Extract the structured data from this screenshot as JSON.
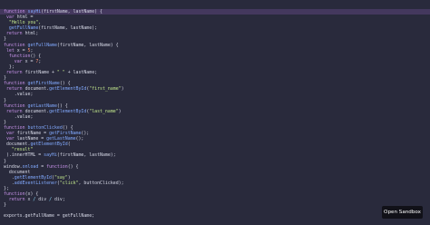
{
  "colors": {
    "background": "#292a3c",
    "highlight": "#44385e",
    "keyword": "#c792ea",
    "function": "#82aaff",
    "string": "#c3e88d",
    "number": "#f78c6c",
    "text": "#d6d8e6",
    "button_bg": "#111118"
  },
  "code_lines": [
    {
      "hl": true,
      "tokens": [
        [
          "key",
          "function "
        ],
        [
          "fn",
          "sayHi"
        ],
        [
          "txt",
          "(firstName, lastName) {"
        ]
      ]
    },
    {
      "tokens": [
        [
          "txt",
          " "
        ],
        [
          "key",
          "var"
        ],
        [
          "txt",
          " html ="
        ]
      ]
    },
    {
      "tokens": [
        [
          "str",
          "  \"Hello you\","
        ]
      ]
    },
    {
      "tokens": [
        [
          "txt",
          "  "
        ],
        [
          "fn",
          "getFullName"
        ],
        [
          "txt",
          "(firstName, lastName);"
        ]
      ]
    },
    {
      "tokens": [
        [
          "txt",
          " "
        ],
        [
          "key",
          "return"
        ],
        [
          "txt",
          " html;"
        ]
      ]
    },
    {
      "tokens": [
        [
          "txt",
          "}"
        ]
      ]
    },
    {
      "tokens": [
        [
          "key",
          "function "
        ],
        [
          "fn",
          "getFullName"
        ],
        [
          "txt",
          "(firstName, lastName) {"
        ]
      ]
    },
    {
      "tokens": [
        [
          "txt",
          " "
        ],
        [
          "key",
          "let"
        ],
        [
          "txt",
          " x = "
        ],
        [
          "num",
          "5"
        ],
        [
          "txt",
          ";"
        ]
      ]
    },
    {
      "tokens": [
        [
          "txt",
          "  "
        ],
        [
          "key",
          "function"
        ],
        [
          "txt",
          "() {"
        ]
      ]
    },
    {
      "tokens": [
        [
          "txt",
          "    "
        ],
        [
          "key",
          "var"
        ],
        [
          "txt",
          " x = "
        ],
        [
          "num",
          "7"
        ],
        [
          "txt",
          ";"
        ]
      ]
    },
    {
      "tokens": [
        [
          "txt",
          "  };"
        ]
      ]
    },
    {
      "tokens": [
        [
          "txt",
          " "
        ],
        [
          "key",
          "return"
        ],
        [
          "txt",
          " firstName + "
        ],
        [
          "str",
          "\" \""
        ],
        [
          "txt",
          " + lastName;"
        ]
      ]
    },
    {
      "tokens": [
        [
          "txt",
          "}"
        ]
      ]
    },
    {
      "tokens": [
        [
          "key",
          "function "
        ],
        [
          "fn",
          "getFirstName"
        ],
        [
          "txt",
          "() {"
        ]
      ]
    },
    {
      "tokens": [
        [
          "txt",
          " "
        ],
        [
          "key",
          "return"
        ],
        [
          "txt",
          " document."
        ],
        [
          "fn",
          "getElementById"
        ],
        [
          "txt",
          "("
        ],
        [
          "str",
          "\"first_name\""
        ],
        [
          "txt",
          ")"
        ]
      ]
    },
    {
      "tokens": [
        [
          "txt",
          "    .value;"
        ]
      ]
    },
    {
      "tokens": [
        [
          "txt",
          "}"
        ]
      ]
    },
    {
      "tokens": [
        [
          "key",
          "function "
        ],
        [
          "fn",
          "getLastName"
        ],
        [
          "txt",
          "() {"
        ]
      ]
    },
    {
      "tokens": [
        [
          "txt",
          " "
        ],
        [
          "key",
          "return"
        ],
        [
          "txt",
          " document."
        ],
        [
          "fn",
          "getElementById"
        ],
        [
          "txt",
          "("
        ],
        [
          "str",
          "\"last_name\""
        ],
        [
          "txt",
          ")"
        ]
      ]
    },
    {
      "tokens": [
        [
          "txt",
          "    .value;"
        ]
      ]
    },
    {
      "tokens": [
        [
          "txt",
          "}"
        ]
      ]
    },
    {
      "tokens": [
        [
          "key",
          "function "
        ],
        [
          "fn",
          "buttonClicked"
        ],
        [
          "txt",
          "() {"
        ]
      ]
    },
    {
      "tokens": [
        [
          "txt",
          " "
        ],
        [
          "key",
          "var"
        ],
        [
          "txt",
          " firstName = "
        ],
        [
          "fn",
          "getFirstName"
        ],
        [
          "txt",
          "();"
        ]
      ]
    },
    {
      "tokens": [
        [
          "txt",
          " "
        ],
        [
          "key",
          "var"
        ],
        [
          "txt",
          " lastName = "
        ],
        [
          "fn",
          "getLastName"
        ],
        [
          "txt",
          "();"
        ]
      ]
    },
    {
      "tokens": [
        [
          "txt",
          " document."
        ],
        [
          "fn",
          "getElementById"
        ],
        [
          "txt",
          "("
        ]
      ]
    },
    {
      "tokens": [
        [
          "str",
          "   \"result\""
        ]
      ]
    },
    {
      "tokens": [
        [
          "txt",
          " ).innerHTML = "
        ],
        [
          "fn",
          "sayHi"
        ],
        [
          "txt",
          "(firstName, lastName);"
        ]
      ]
    },
    {
      "tokens": [
        [
          "txt",
          "}"
        ]
      ]
    },
    {
      "tokens": [
        [
          "txt",
          "window."
        ],
        [
          "fn",
          "onload"
        ],
        [
          "txt",
          " = "
        ],
        [
          "key",
          "function"
        ],
        [
          "txt",
          "() {"
        ]
      ]
    },
    {
      "tokens": [
        [
          "txt",
          "  document"
        ]
      ]
    },
    {
      "tokens": [
        [
          "txt",
          "   ."
        ],
        [
          "fn",
          "getElementById"
        ],
        [
          "txt",
          "("
        ],
        [
          "str",
          "\"say\""
        ],
        [
          "txt",
          ")"
        ]
      ]
    },
    {
      "tokens": [
        [
          "txt",
          "   ."
        ],
        [
          "fn",
          "addEventListener"
        ],
        [
          "txt",
          "("
        ],
        [
          "str",
          "\"click\""
        ],
        [
          "txt",
          ", buttonClicked);"
        ]
      ]
    },
    {
      "tokens": [
        [
          "txt",
          "};"
        ]
      ]
    },
    {
      "tokens": [
        [
          "key",
          "function"
        ],
        [
          "txt",
          "(x) {"
        ]
      ]
    },
    {
      "tokens": [
        [
          "txt",
          "  "
        ],
        [
          "key",
          "return"
        ],
        [
          "txt",
          " x "
        ],
        [
          "op",
          "/"
        ],
        [
          "txt",
          " div "
        ],
        [
          "op",
          "/"
        ],
        [
          "txt",
          " div;"
        ]
      ]
    },
    {
      "tokens": [
        [
          "txt",
          "}"
        ]
      ]
    },
    {
      "tokens": [
        [
          "txt",
          ""
        ]
      ]
    },
    {
      "tokens": [
        [
          "txt",
          "exports.getFullName = getFullName;"
        ]
      ]
    }
  ],
  "open_button": {
    "label": "Open Sandbox"
  }
}
